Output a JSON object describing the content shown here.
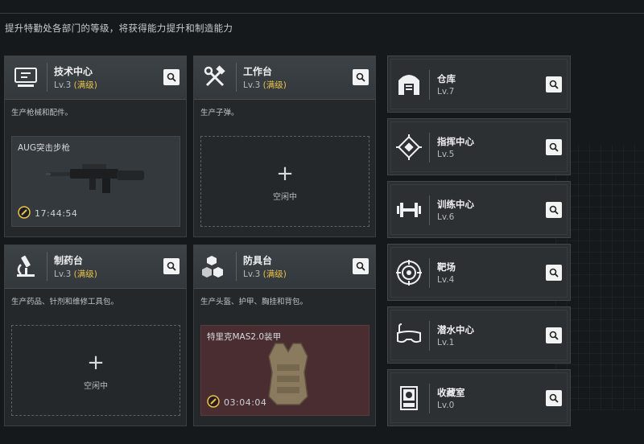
{
  "subtitle": "提升特勤处各部门的等级，将获得能力提升和制造能力",
  "cards": [
    {
      "name": "技术中心",
      "level": "Lv.3",
      "max_label": "(满级)",
      "desc": "生产枪械和配件。",
      "item_name": "AUG突击步枪",
      "timer": "17:44:54"
    },
    {
      "name": "工作台",
      "level": "Lv.3",
      "max_label": "(满级)",
      "desc": "生产子弹。",
      "plus": "+",
      "idle": "空闲中"
    },
    {
      "name": "制药台",
      "level": "Lv.3",
      "max_label": "(满级)",
      "desc": "生产药品、针剂和维修工具包。",
      "plus": "+",
      "idle": "空闲中"
    },
    {
      "name": "防具台",
      "level": "Lv.3",
      "max_label": "(满级)",
      "desc": "生产头盔、护甲、胸挂和背包。",
      "item_name": "特里克MAS2.0装甲",
      "timer": "03:04:04"
    }
  ],
  "side": [
    {
      "name": "仓库",
      "level": "Lv.7",
      "icon": "warehouse-icon"
    },
    {
      "name": "指挥中心",
      "level": "Lv.5",
      "icon": "command-chip-icon"
    },
    {
      "name": "训练中心",
      "level": "Lv.6",
      "icon": "dumbbell-icon"
    },
    {
      "name": "靶场",
      "level": "Lv.4",
      "icon": "target-icon"
    },
    {
      "name": "潜水中心",
      "level": "Lv.1",
      "icon": "diving-mask-icon"
    },
    {
      "name": "收藏室",
      "level": "Lv.0",
      "icon": "collection-cabinet-icon"
    }
  ]
}
